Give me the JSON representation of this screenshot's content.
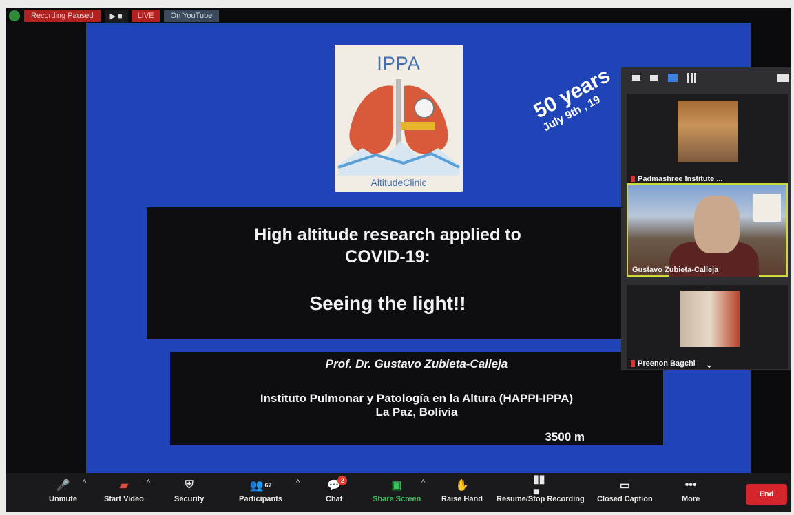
{
  "recording": {
    "status_label": "Recording Paused",
    "live_label": "LIVE",
    "live_status": "On YouTube"
  },
  "slide": {
    "logo_title": "IPPA",
    "logo_subtitle": "AltitudeClinic",
    "anniversary_big": "50 years",
    "anniversary_small": "July 9th , 19",
    "title_line1": "High altitude research applied to",
    "title_line2": "COVID-19:",
    "title_line3": "Seeing the light!!",
    "author": "Prof. Dr. Gustavo Zubieta-Calleja",
    "institute_line1": "Instituto Pulmonar y Patología en la Altura (HAPPI-IPPA)",
    "institute_line2": "La Paz, Bolivia",
    "altitude": "3500 m"
  },
  "participants_panel": {
    "tiles": [
      {
        "name": "Padmashree Institute ..."
      },
      {
        "name": "Gustavo Zubieta-Calleja"
      },
      {
        "name": "Preenon Bagchi"
      }
    ]
  },
  "toolbar": {
    "unmute": "Unmute",
    "start_video": "Start Video",
    "security": "Security",
    "participants": "Participants",
    "participants_count": "67",
    "chat": "Chat",
    "chat_badge": "2",
    "share_screen": "Share Screen",
    "raise_hand": "Raise Hand",
    "resume_stop_recording": "Resume/Stop Recording",
    "closed_caption": "Closed Caption",
    "more": "More",
    "end": "End"
  }
}
